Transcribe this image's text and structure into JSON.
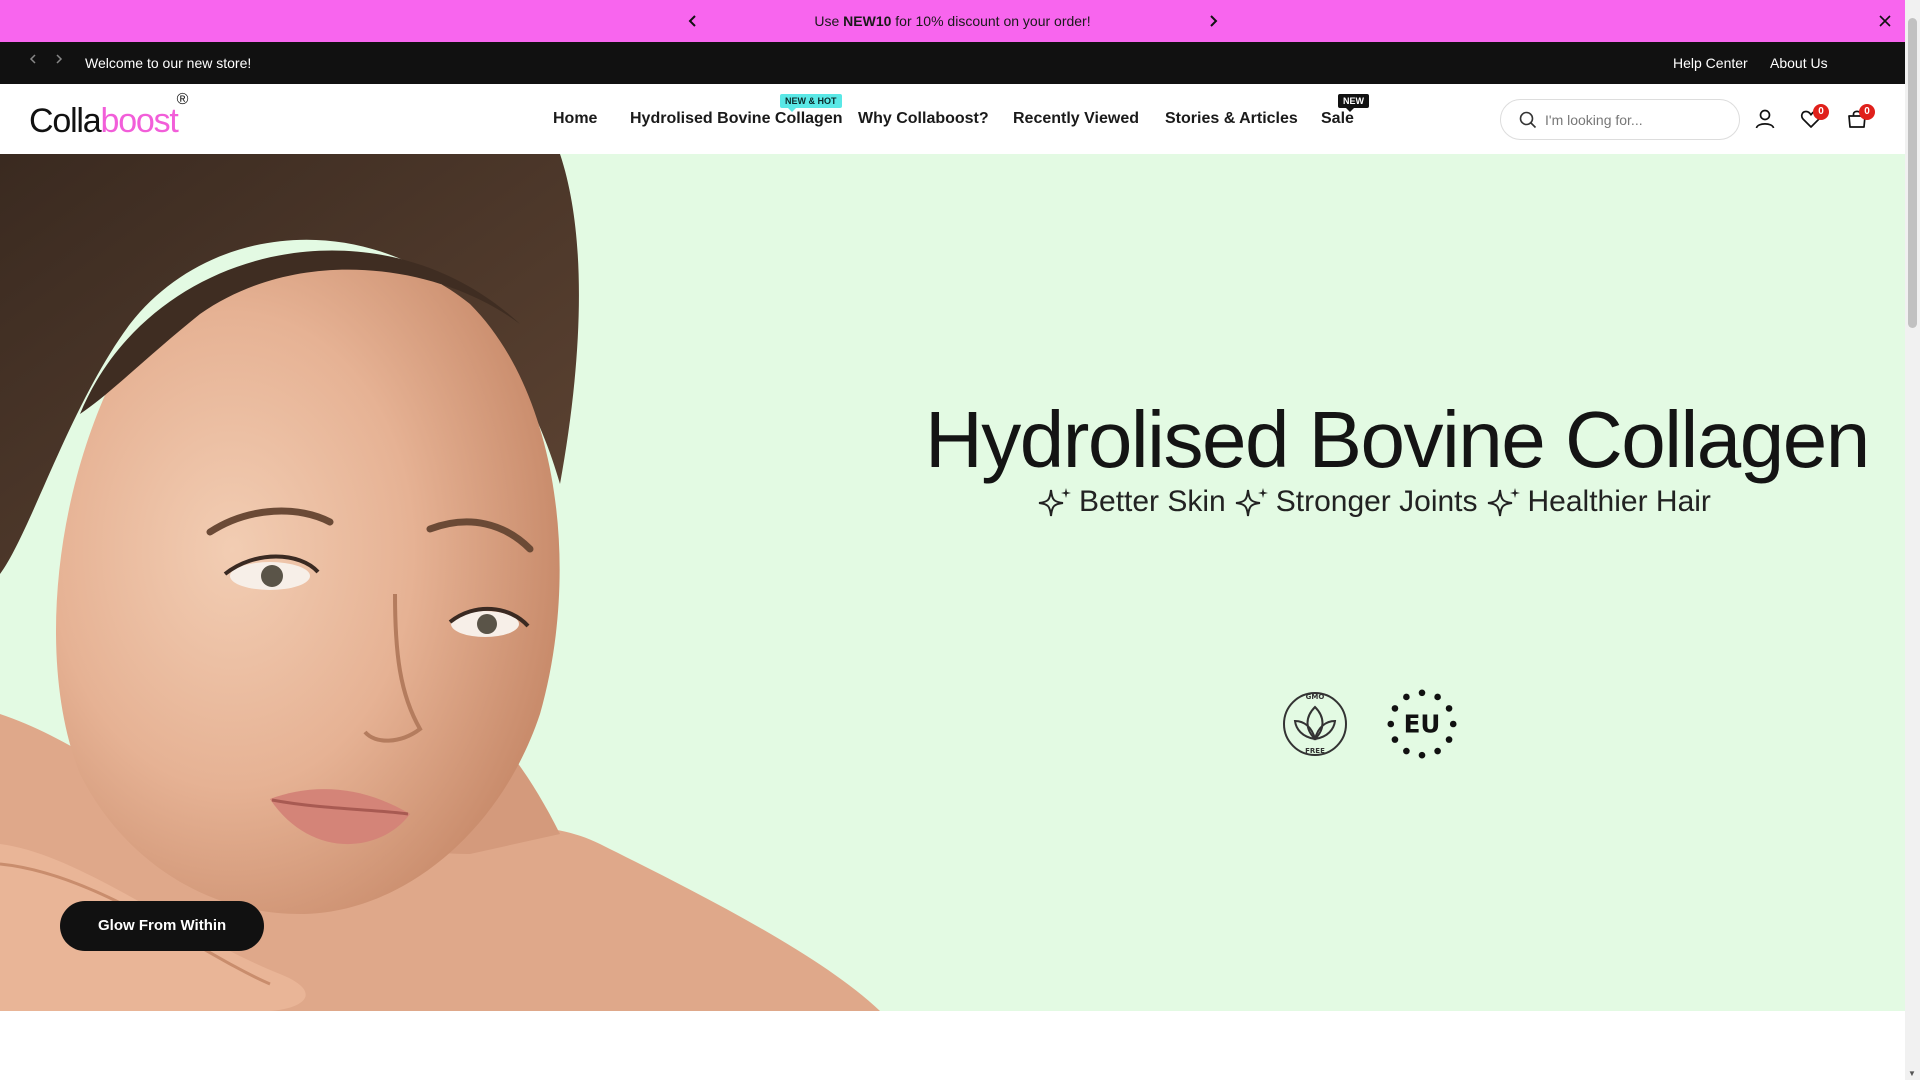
{
  "promo": {
    "text_prefix": "Use ",
    "code": "NEW10",
    "text_suffix": " for 10% discount on your order!"
  },
  "topbar": {
    "welcome": "Welcome to our new store!",
    "links": [
      "Help Center",
      "About Us"
    ]
  },
  "header": {
    "logo_part1": "Colla",
    "logo_part2": "boost",
    "logo_mark": "®",
    "nav": [
      "Home",
      "Hydrolised Bovine Collagen",
      "Why Collaboost?",
      "Recently Viewed",
      "Stories & Articles",
      "Sale"
    ],
    "badges": {
      "collagen": "NEW & HOT",
      "sale": "NEW"
    },
    "search_placeholder": "I'm looking for...",
    "wishlist_count": "0",
    "cart_count": "0"
  },
  "hero": {
    "title": "Hydrolised Bovine Collagen",
    "benefits": [
      "Better Skin",
      "Stronger Joints",
      "Healthier Hair"
    ],
    "cta": "Glow From Within",
    "cert_gmo": "GMO FREE",
    "cert_eu": "EU"
  },
  "colors": {
    "promo_bg": "#f865ee",
    "topbar_bg": "#111111",
    "hero_bg": "#e3fae3",
    "brand_pink": "#f25ed9",
    "badge_teal": "#5ae8e6",
    "count_red": "#e0201b"
  }
}
